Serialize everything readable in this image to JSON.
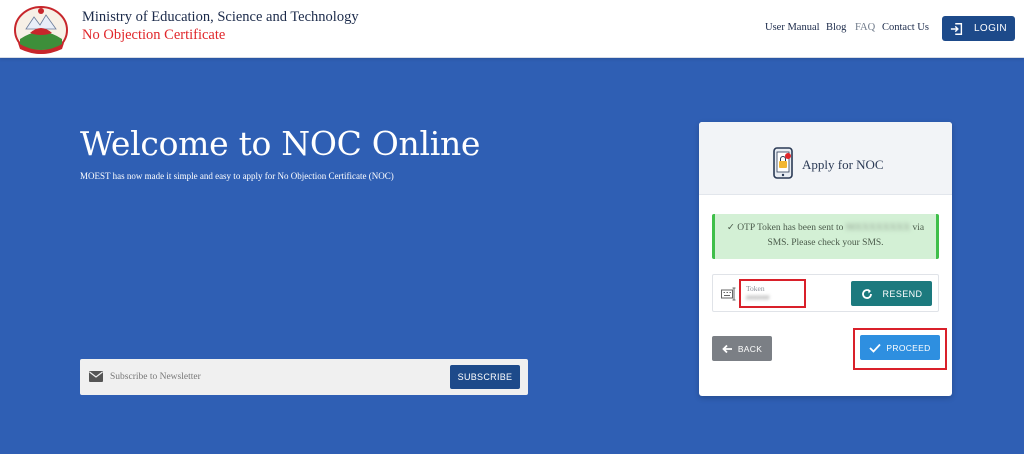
{
  "header": {
    "title": "Ministry of Education, Science and Technology",
    "subtitle": "No Objection Certificate",
    "nav": [
      "User Manual",
      "Blog",
      "FAQ",
      "Contact Us"
    ],
    "login_label": "LOGIN",
    "login_icon": "login-icon",
    "logo_icon": "nepal-emblem-icon"
  },
  "hero": {
    "title": "Welcome to NOC Online",
    "subtitle": "MOEST has now made it simple and easy to apply for No Objection Certificate (NOC)"
  },
  "newsletter": {
    "placeholder": "Subscribe to Newsletter",
    "button_label": "SUBSCRIBE",
    "icon": "mail-icon"
  },
  "card": {
    "title": "Apply for NOC",
    "icon": "phone-lock-icon",
    "alert": {
      "prefix": "✓ OTP Token has been sent to",
      "masked_number": "98XXXXXXXX",
      "suffix": "via",
      "line2": "SMS. Please check your SMS."
    },
    "token": {
      "label": "Token",
      "value": "######"
    },
    "resend_label": "RESEND",
    "back_label": "BACK",
    "proceed_label": "PROCEED"
  },
  "colors": {
    "background": "#2f5fb4",
    "primary": "#1d4a8a",
    "teal": "#1c7a7e",
    "proceed": "#2e8fe0",
    "highlight": "#d9202a",
    "alert_bg": "#d3f0d5",
    "alert_border": "#3fbf4a"
  }
}
